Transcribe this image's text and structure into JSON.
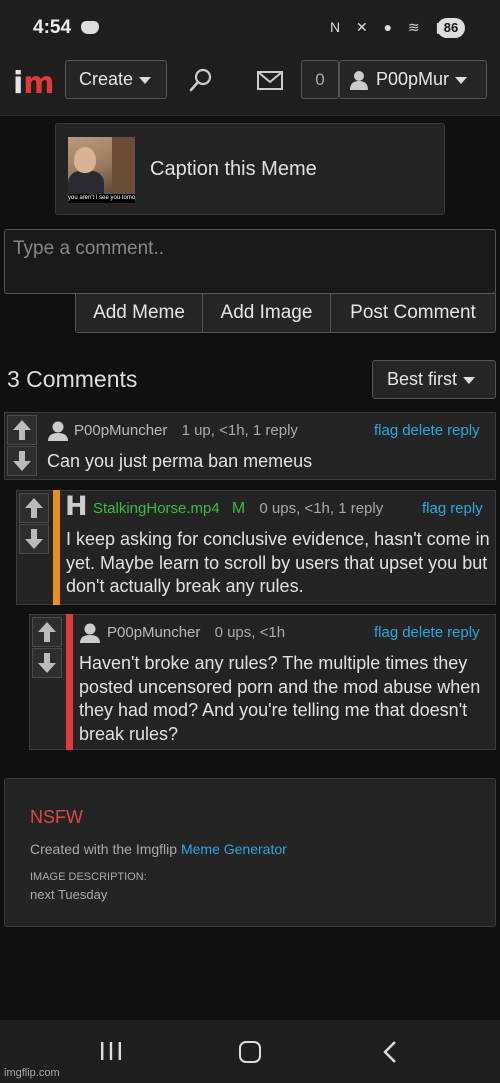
{
  "status_bar": {
    "time": "4:54",
    "battery": "86"
  },
  "nav": {
    "logo_i": "i",
    "logo_m": "m",
    "create_label": "Create",
    "notif_count": "0",
    "username": "P00pMur"
  },
  "meme": {
    "title": "Caption this Meme",
    "thumb_caption": "you aren't I see you tomor"
  },
  "comment_box": {
    "placeholder": "Type a comment..",
    "add_meme": "Add Meme",
    "add_image": "Add Image",
    "post_comment": "Post Comment"
  },
  "comments_header": {
    "count_label": "3 Comments",
    "sort_label": "Best first"
  },
  "comments": [
    {
      "username": "P00pMuncher",
      "stats": "1 up, <1h, 1 reply",
      "links": [
        "flag",
        "delete",
        "reply"
      ],
      "text": "Can you just perma ban memeus"
    },
    {
      "username": "StalkingHorse.mp4",
      "badge": "M",
      "avatar_letter": "H",
      "stats": "0 ups, <1h, 1 reply",
      "links": [
        "flag",
        "reply"
      ],
      "text": "I keep asking for conclusive evidence, hasn't come in yet. Maybe learn to scroll by users that upset you but don't actually break any rules.",
      "accent_color": "#e8901c"
    },
    {
      "username": "P00pMuncher",
      "stats": "0 ups, <1h",
      "links": [
        "flag",
        "delete",
        "reply"
      ],
      "text": "Haven't broke any rules? The multiple times they posted uncensored porn and the mod abuse when they had mod? And you're telling me that doesn't break rules?",
      "accent_color": "#e03a3a"
    }
  ],
  "image_info": {
    "nsfw": "NSFW",
    "created_prefix": "Created with the Imgflip",
    "generator_link": "Meme Generator",
    "desc_label": "IMAGE DESCRIPTION:",
    "desc_value": "next Tuesday"
  },
  "watermark": "imgflip.com"
}
